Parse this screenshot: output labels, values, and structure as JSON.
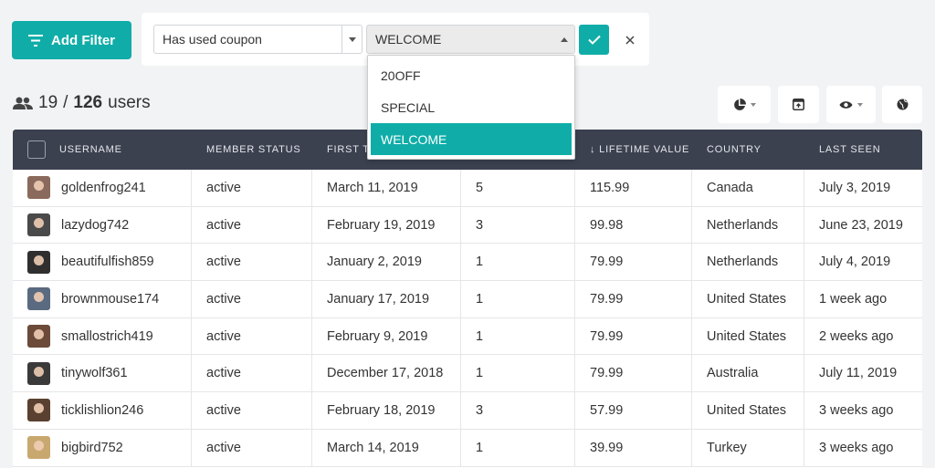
{
  "toolbar": {
    "add_filter_label": "Add Filter",
    "filter_field": "Has used coupon",
    "filter_value": "WELCOME"
  },
  "dropdown": {
    "options": [
      "20OFF",
      "SPECIAL",
      "WELCOME"
    ],
    "selected": "WELCOME"
  },
  "summary": {
    "filtered": "19",
    "separator": "/",
    "total": "126",
    "unit": "users"
  },
  "table": {
    "columns": [
      "Username",
      "Member Status",
      "First T",
      "",
      "↓ Lifetime Value",
      "Country",
      "Last Seen"
    ],
    "rows": [
      {
        "username": "goldenfrog241",
        "status": "active",
        "first": "March 11, 2019",
        "orders": "5",
        "value": "115.99",
        "country": "Canada",
        "last_seen": "July 3, 2019",
        "avatar": "#8a6a5c"
      },
      {
        "username": "lazydog742",
        "status": "active",
        "first": "February 19, 2019",
        "orders": "3",
        "value": "99.98",
        "country": "Netherlands",
        "last_seen": "June 23, 2019",
        "avatar": "#4a4a4a"
      },
      {
        "username": "beautifulfish859",
        "status": "active",
        "first": "January 2, 2019",
        "orders": "1",
        "value": "79.99",
        "country": "Netherlands",
        "last_seen": "July 4, 2019",
        "avatar": "#2f2f2f"
      },
      {
        "username": "brownmouse174",
        "status": "active",
        "first": "January 17, 2019",
        "orders": "1",
        "value": "79.99",
        "country": "United States",
        "last_seen": "1 week ago",
        "avatar": "#5a6a80"
      },
      {
        "username": "smallostrich419",
        "status": "active",
        "first": "February 9, 2019",
        "orders": "1",
        "value": "79.99",
        "country": "United States",
        "last_seen": "2 weeks ago",
        "avatar": "#6b4a3a"
      },
      {
        "username": "tinywolf361",
        "status": "active",
        "first": "December 17, 2018",
        "orders": "1",
        "value": "79.99",
        "country": "Australia",
        "last_seen": "July 11, 2019",
        "avatar": "#3a3a3a"
      },
      {
        "username": "ticklishlion246",
        "status": "active",
        "first": "February 18, 2019",
        "orders": "3",
        "value": "57.99",
        "country": "United States",
        "last_seen": "3 weeks ago",
        "avatar": "#5a4030"
      },
      {
        "username": "bigbird752",
        "status": "active",
        "first": "March 14, 2019",
        "orders": "1",
        "value": "39.99",
        "country": "Turkey",
        "last_seen": "3 weeks ago",
        "avatar": "#c9a870"
      }
    ]
  },
  "colors": {
    "accent": "#10ada8",
    "header_bg": "#3c4150"
  },
  "icons": {
    "filter": "filter-lines-icon",
    "users": "users-icon",
    "chart": "pie-chart-icon",
    "export": "export-icon",
    "view": "eye-icon",
    "globe": "globe-icon"
  }
}
